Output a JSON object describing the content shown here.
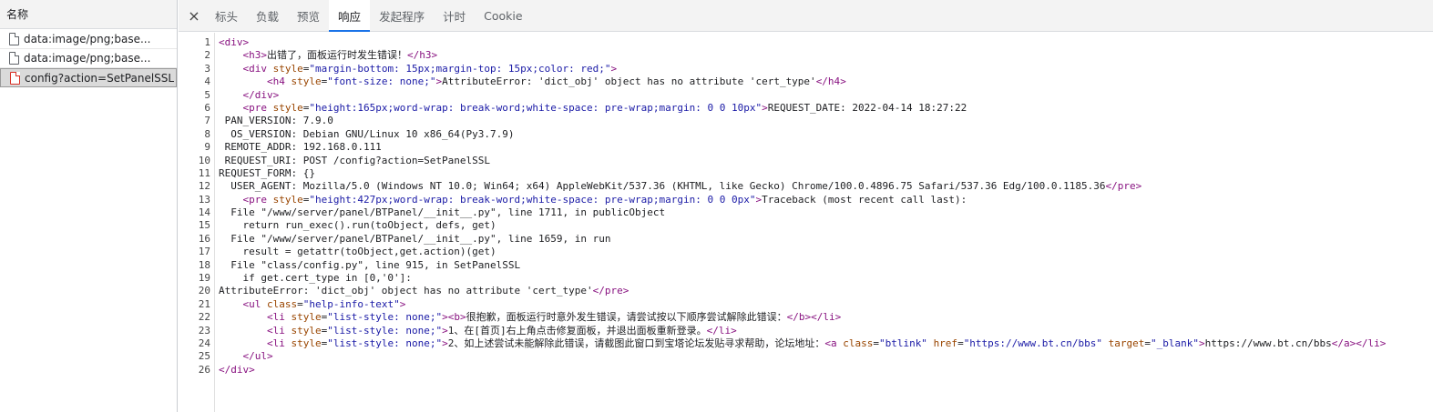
{
  "request_list": {
    "header": "名称",
    "items": [
      {
        "name": "data:image/png;base...",
        "status": "normal"
      },
      {
        "name": "data:image/png;base...",
        "status": "normal"
      },
      {
        "name": "config?action=SetPanelSSL",
        "status": "error"
      }
    ]
  },
  "detail_tabs": {
    "close_label": "×",
    "tabs": [
      "标头",
      "负载",
      "预览",
      "响应",
      "发起程序",
      "计时",
      "Cookie"
    ],
    "active": "响应"
  },
  "response": {
    "line_numbers": [
      "1",
      "2",
      "3",
      "4",
      "5",
      "6",
      "7",
      "8",
      "9",
      "10",
      "11",
      "12",
      "13",
      "14",
      "15",
      "16",
      "17",
      "18",
      "19",
      "20",
      "21",
      "22",
      "23",
      "24",
      "25",
      "26"
    ],
    "lines": [
      "<div>",
      "    <h3>出错了，面板运行时发生错误！</h3>",
      "    <div style=\"margin-bottom: 15px;margin-top: 15px;color: red;\">",
      "        <h4 style=\"font-size: none;\">AttributeError: 'dict_obj' object has no attribute 'cert_type'</h4>",
      "    </div>",
      "    <pre style=\"height:165px;word-wrap: break-word;white-space: pre-wrap;margin: 0 0 10px\">REQUEST_DATE: 2022-04-14 18:27:22",
      " PAN_VERSION: 7.9.0",
      "  OS_VERSION: Debian GNU/Linux 10 x86_64(Py3.7.9)",
      " REMOTE_ADDR: 192.168.0.111",
      " REQUEST_URI: POST /config?action=SetPanelSSL",
      "REQUEST_FORM: {}",
      "  USER_AGENT: Mozilla/5.0 (Windows NT 10.0; Win64; x64) AppleWebKit/537.36 (KHTML, like Gecko) Chrome/100.0.4896.75 Safari/537.36 Edg/100.0.1185.36</pre>",
      "    <pre style=\"height:427px;word-wrap: break-word;white-space: pre-wrap;margin: 0 0 0px\">Traceback (most recent call last):",
      "  File \"/www/server/panel/BTPanel/__init__.py\", line 1711, in publicObject",
      "    return run_exec().run(toObject, defs, get)",
      "  File \"/www/server/panel/BTPanel/__init__.py\", line 1659, in run",
      "    result = getattr(toObject,get.action)(get)",
      "  File \"class/config.py\", line 915, in SetPanelSSL",
      "    if get.cert_type in [0,'0']:",
      "AttributeError: 'dict_obj' object has no attribute 'cert_type'</pre>",
      "    <ul class=\"help-info-text\">",
      "        <li style=\"list-style: none;\"><b>很抱歉，面板运行时意外发生错误，请尝试按以下顺序尝试解除此错误：</b></li>",
      "        <li style=\"list-style: none;\">1、在[首页]右上角点击修复面板，并退出面板重新登录。</li>",
      "        <li style=\"list-style: none;\">2、如上述尝试未能解除此错误，请截图此窗口到宝塔论坛发贴寻求帮助，论坛地址：<a class=\"btlink\" href=\"https://www.bt.cn/bbs\" target=\"_blank\">https://www.bt.cn/bbs</a></li>",
      "    </ul>",
      "</div>"
    ]
  }
}
